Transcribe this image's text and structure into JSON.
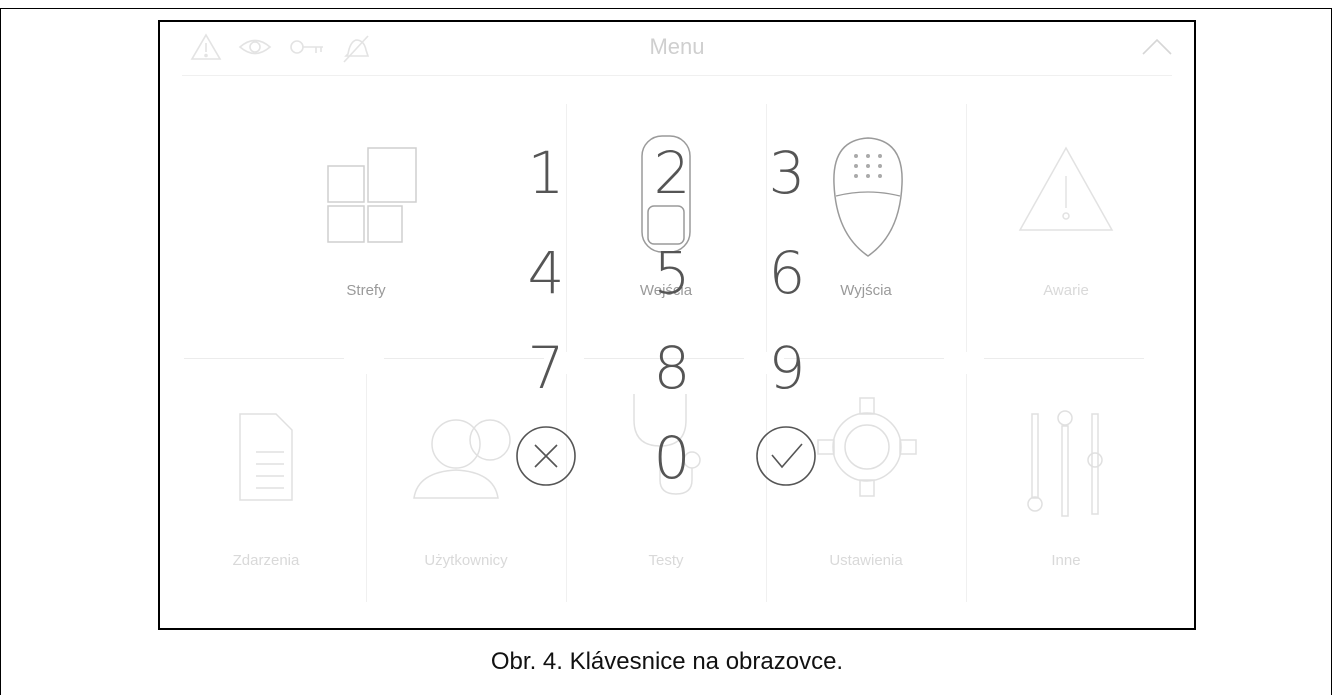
{
  "header": {
    "title": "Menu",
    "icons": [
      "warning-icon",
      "eye-icon",
      "key-icon",
      "bell-off-icon",
      "chevron-up-icon"
    ]
  },
  "menu_tiles": [
    {
      "label": "Strefy",
      "icon": "zones-icon"
    },
    {
      "label": "Wejścia",
      "icon": "detector-icon"
    },
    {
      "label": "Wyjścia",
      "icon": "siren-icon"
    },
    {
      "label": "Awarie",
      "icon": "warning-triangle-icon"
    },
    {
      "label": "Zdarzenia",
      "icon": "document-list-icon"
    },
    {
      "label": "Użytkownicy",
      "icon": "users-icon"
    },
    {
      "label": "Testy",
      "icon": "stethoscope-icon"
    },
    {
      "label": "Ustawienia",
      "icon": "gear-icon"
    },
    {
      "label": "Inne",
      "icon": "sliders-icon"
    }
  ],
  "keypad": {
    "keys": [
      "1",
      "2",
      "3",
      "4",
      "5",
      "6",
      "7",
      "8",
      "9",
      "0"
    ],
    "cancel_icon": "cancel-icon",
    "confirm_icon": "confirm-icon"
  },
  "caption": "Obr. 4. Klávesnice na obrazovce."
}
